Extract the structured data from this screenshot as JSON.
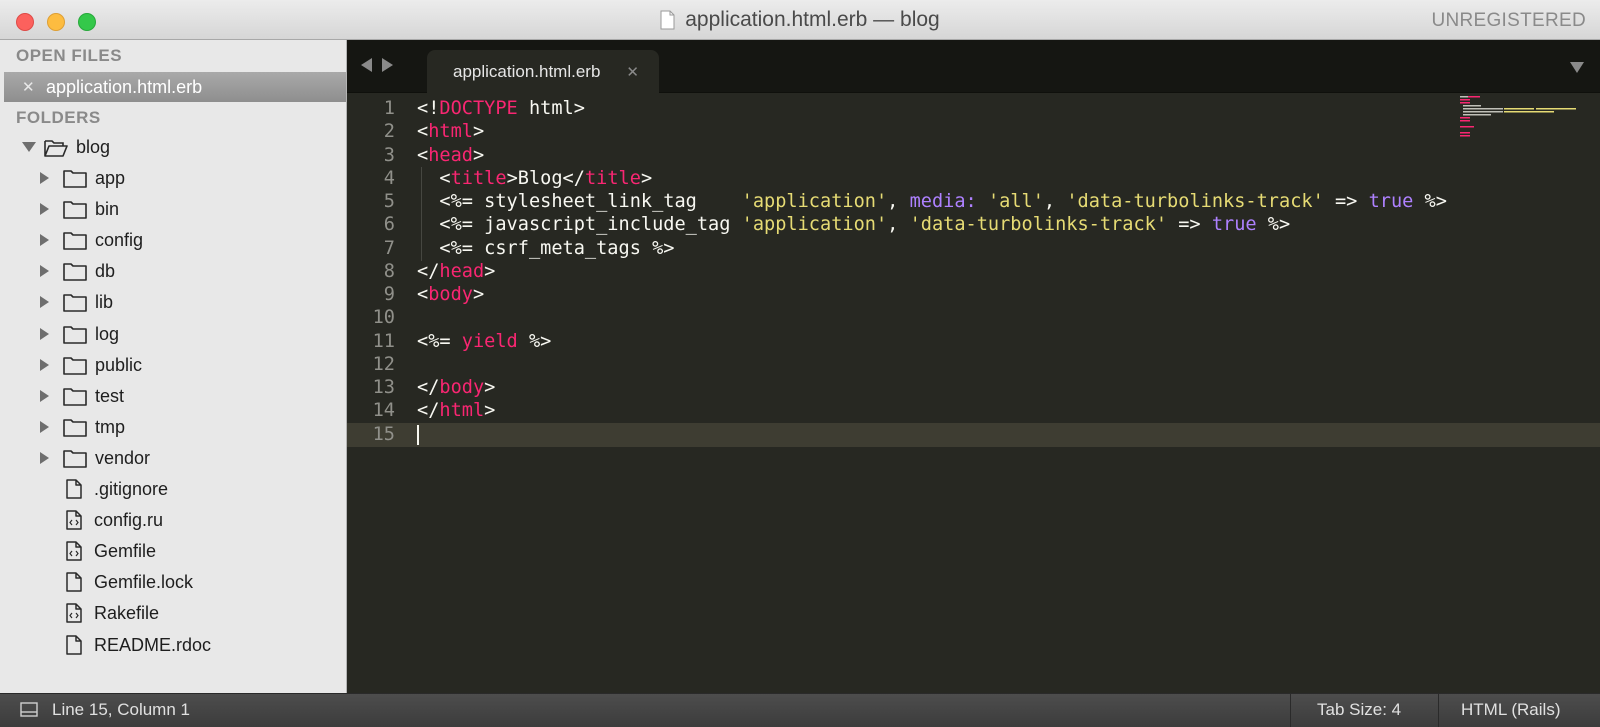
{
  "window": {
    "title": "application.html.erb — blog",
    "unregistered": "UNREGISTERED"
  },
  "sidebar": {
    "open_files_header": "OPEN FILES",
    "open_files": [
      {
        "name": "application.html.erb",
        "close_glyph": "✕"
      }
    ],
    "folders_header": "FOLDERS",
    "root": {
      "name": "blog",
      "expanded": true
    },
    "items": [
      {
        "name": "app",
        "type": "folder"
      },
      {
        "name": "bin",
        "type": "folder"
      },
      {
        "name": "config",
        "type": "folder"
      },
      {
        "name": "db",
        "type": "folder"
      },
      {
        "name": "lib",
        "type": "folder"
      },
      {
        "name": "log",
        "type": "folder"
      },
      {
        "name": "public",
        "type": "folder"
      },
      {
        "name": "test",
        "type": "folder"
      },
      {
        "name": "tmp",
        "type": "folder"
      },
      {
        "name": "vendor",
        "type": "folder"
      },
      {
        "name": ".gitignore",
        "type": "file"
      },
      {
        "name": "config.ru",
        "type": "code-file"
      },
      {
        "name": "Gemfile",
        "type": "code-file"
      },
      {
        "name": "Gemfile.lock",
        "type": "file"
      },
      {
        "name": "Rakefile",
        "type": "code-file"
      },
      {
        "name": "README.rdoc",
        "type": "file"
      }
    ]
  },
  "editor": {
    "tab": {
      "label": "application.html.erb",
      "close_glyph": "✕"
    },
    "active_line": 15,
    "lines": [
      {
        "num": "1",
        "tokens": [
          {
            "t": "<!"
          },
          {
            "t": "DOCTYPE",
            "c": "tag"
          },
          {
            "t": " html>"
          }
        ]
      },
      {
        "num": "2",
        "tokens": [
          {
            "t": "<"
          },
          {
            "t": "html",
            "c": "tag"
          },
          {
            "t": ">"
          }
        ]
      },
      {
        "num": "3",
        "tokens": [
          {
            "t": "<"
          },
          {
            "t": "head",
            "c": "tag"
          },
          {
            "t": ">"
          }
        ]
      },
      {
        "num": "4",
        "tokens": [
          {
            "t": "  <"
          },
          {
            "t": "title",
            "c": "tag"
          },
          {
            "t": ">Blog</"
          },
          {
            "t": "title",
            "c": "tag"
          },
          {
            "t": ">"
          }
        ]
      },
      {
        "num": "5",
        "tokens": [
          {
            "t": "  <%= stylesheet_link_tag    "
          },
          {
            "t": "'application'",
            "c": "str"
          },
          {
            "t": ", "
          },
          {
            "t": "media:",
            "c": "sym"
          },
          {
            "t": " "
          },
          {
            "t": "'all'",
            "c": "str"
          },
          {
            "t": ", "
          },
          {
            "t": "'data-turbolinks-track'",
            "c": "str"
          },
          {
            "t": " => "
          },
          {
            "t": "true",
            "c": "sym"
          },
          {
            "t": " %>"
          }
        ]
      },
      {
        "num": "6",
        "tokens": [
          {
            "t": "  <%= javascript_include_tag "
          },
          {
            "t": "'application'",
            "c": "str"
          },
          {
            "t": ", "
          },
          {
            "t": "'data-turbolinks-track'",
            "c": "str"
          },
          {
            "t": " => "
          },
          {
            "t": "true",
            "c": "sym"
          },
          {
            "t": " %>"
          }
        ]
      },
      {
        "num": "7",
        "tokens": [
          {
            "t": "  <%= csrf_meta_tags %>"
          }
        ]
      },
      {
        "num": "8",
        "tokens": [
          {
            "t": "</"
          },
          {
            "t": "head",
            "c": "tag"
          },
          {
            "t": ">"
          }
        ]
      },
      {
        "num": "9",
        "tokens": [
          {
            "t": "<"
          },
          {
            "t": "body",
            "c": "tag"
          },
          {
            "t": ">"
          }
        ]
      },
      {
        "num": "10",
        "tokens": []
      },
      {
        "num": "11",
        "tokens": [
          {
            "t": "<%= "
          },
          {
            "t": "yield",
            "c": "tag"
          },
          {
            "t": " %>"
          }
        ]
      },
      {
        "num": "12",
        "tokens": []
      },
      {
        "num": "13",
        "tokens": [
          {
            "t": "</"
          },
          {
            "t": "body",
            "c": "tag"
          },
          {
            "t": ">"
          }
        ]
      },
      {
        "num": "14",
        "tokens": [
          {
            "t": "</"
          },
          {
            "t": "html",
            "c": "tag"
          },
          {
            "t": ">"
          }
        ]
      },
      {
        "num": "15",
        "tokens": []
      }
    ]
  },
  "statusbar": {
    "position": "Line 15, Column 1",
    "tab_size": "Tab Size: 4",
    "syntax": "HTML (Rails)"
  },
  "colors": {
    "editor_bg": "#272822",
    "tag": "#f92672",
    "string": "#e6db74",
    "symbol": "#ae81ff",
    "text": "#f8f8f2"
  }
}
